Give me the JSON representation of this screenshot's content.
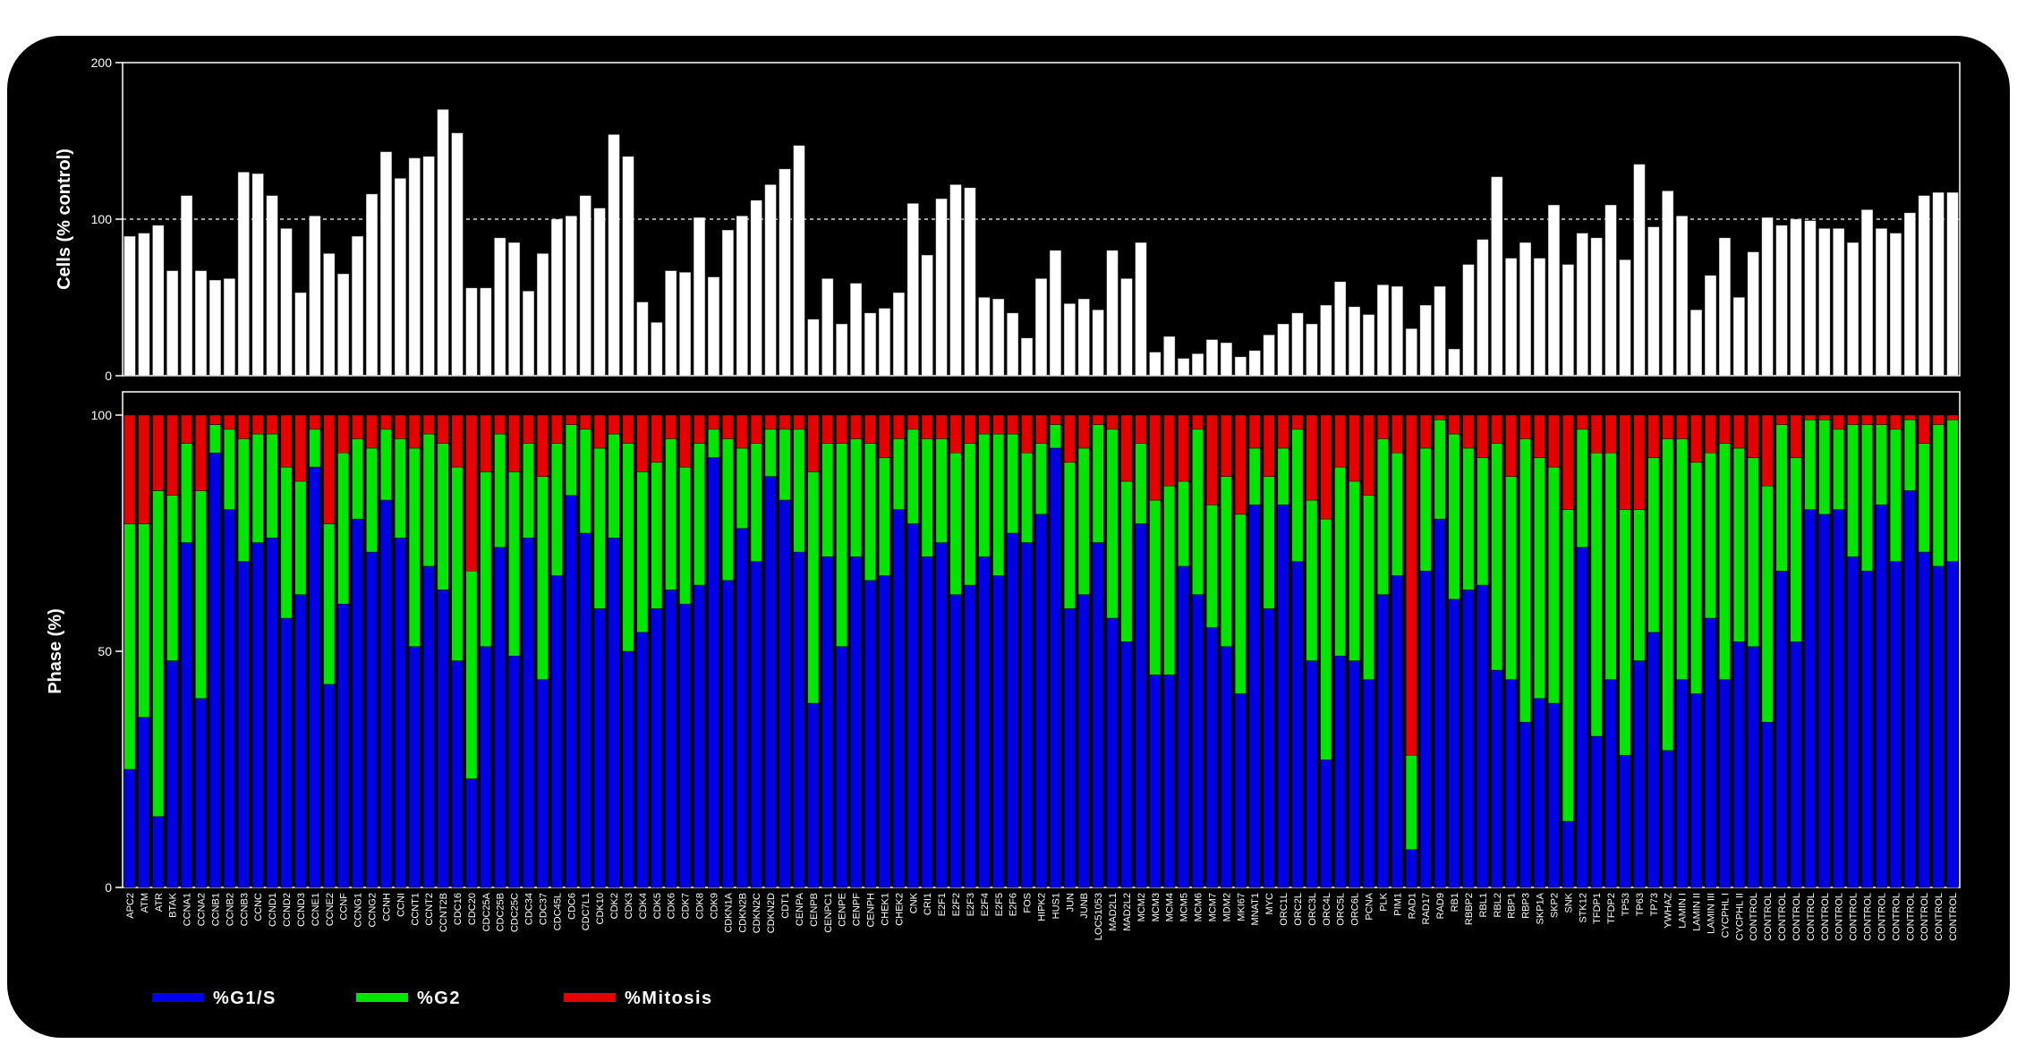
{
  "chart_data": [
    {
      "type": "bar",
      "ylabel": "Cells (% control)",
      "ylim": [
        0,
        200
      ],
      "yticks": [
        0,
        100,
        200
      ],
      "reference_line": 100,
      "grid": false,
      "categories": [
        "APC2",
        "ATM",
        "ATR",
        "BTAK",
        "CCNA1",
        "CCNA2",
        "CCNB1",
        "CCNB2",
        "CCNB3",
        "CCNC",
        "CCND1",
        "CCND2",
        "CCND3",
        "CCNE1",
        "CCNE2",
        "CCNF",
        "CCNG1",
        "CCNG2",
        "CCNH",
        "CCNI",
        "CCNT1",
        "CCNT2",
        "CCNT2B",
        "CDC16",
        "CDC20",
        "CDC25A",
        "CDC25B",
        "CDC25C",
        "CDC34",
        "CDC37",
        "CDC45L",
        "CDC6",
        "CDC7L1",
        "CDK10",
        "CDK2",
        "CDK3",
        "CDK4",
        "CDK5",
        "CDK6",
        "CDK7",
        "CDK8",
        "CDK9",
        "CDKN1A",
        "CDKN2B",
        "CDKN2C",
        "CDKN2D",
        "CDT1",
        "CENPA",
        "CENPB",
        "CENPC1",
        "CENPE",
        "CENPF",
        "CENPH",
        "CHEK1",
        "CHEK2",
        "CNK",
        "CRI1",
        "E2F1",
        "E2F2",
        "E2F3",
        "E2F4",
        "E2F5",
        "E2F6",
        "FOS",
        "HIPK2",
        "HUS1",
        "JUN",
        "JUNB",
        "LOC51053",
        "MAD2L1",
        "MAD2L2",
        "MCM2",
        "MCM3",
        "MCM4",
        "MCM5",
        "MCM6",
        "MCM7",
        "MDM2",
        "MKI67",
        "MNAT1",
        "MYC",
        "ORC1L",
        "ORC2L",
        "ORC3L",
        "ORC4L",
        "ORC5L",
        "ORC6L",
        "PCNA",
        "PLK",
        "PIM1",
        "RAD1",
        "RAD17",
        "RAD9",
        "RB1",
        "RBBP2",
        "RBL1",
        "RBL2",
        "RBP1",
        "RBP3",
        "SKP1A",
        "SKP2",
        "SNK",
        "STK12",
        "TFDP1",
        "TFDP2",
        "TP53",
        "TP63",
        "TP73",
        "YWHAZ",
        "LAMIN I",
        "LAMIN II",
        "LAMIN III",
        "CYCPHL I",
        "CYCPHL II",
        "CONTROL",
        "CONTROL",
        "CONTROL",
        "CONTROL",
        "CONTROL",
        "CONTROL",
        "CONTROL",
        "CONTROL",
        "CONTROL",
        "CONTROL",
        "CONTROL",
        "CONTROL",
        "CONTROL",
        "CONTROL",
        "CONTROL"
      ],
      "values": [
        89,
        91,
        96,
        67,
        115,
        67,
        61,
        62,
        130,
        129,
        115,
        94,
        53,
        102,
        78,
        65,
        89,
        116,
        143,
        126,
        139,
        140,
        170,
        155,
        56,
        56,
        88,
        85,
        54,
        78,
        100,
        102,
        115,
        107,
        154,
        140,
        47,
        34,
        67,
        66,
        101,
        63,
        93,
        102,
        112,
        122,
        132,
        147,
        36,
        62,
        33,
        59,
        40,
        43,
        53,
        110,
        77,
        113,
        122,
        120,
        50,
        49,
        40,
        24,
        62,
        80,
        46,
        49,
        42,
        80,
        62,
        85,
        15,
        25,
        11,
        14,
        23,
        21,
        12,
        16,
        26,
        33,
        40,
        33,
        45,
        60,
        44,
        39,
        58,
        57,
        30,
        45,
        57,
        17,
        71,
        87,
        127,
        75,
        85,
        75,
        109,
        71,
        91,
        88,
        109,
        74,
        135,
        95,
        118,
        102,
        42,
        64,
        88,
        50,
        79,
        101,
        96,
        100,
        99,
        94,
        94,
        85,
        106,
        94,
        91,
        104,
        115,
        117,
        117
      ]
    },
    {
      "type": "bar",
      "stacked": true,
      "ylabel": "Phase (%)",
      "ylim": [
        0,
        100
      ],
      "yticks": [
        0,
        50,
        100
      ],
      "grid": false,
      "legend_position": "bottom-left",
      "categories_ref": "same as panel above",
      "series": [
        {
          "name": "%G1/S",
          "color": "#0000e6",
          "values": [
            25,
            36,
            15,
            48,
            73,
            40,
            92,
            80,
            69,
            73,
            74,
            57,
            62,
            89,
            43,
            60,
            78,
            71,
            82,
            74,
            51,
            68,
            63,
            48,
            23,
            51,
            72,
            49,
            74,
            44,
            66,
            83,
            75,
            59,
            74,
            50,
            54,
            59,
            63,
            60,
            64,
            91,
            65,
            76,
            69,
            87,
            82,
            71,
            39,
            70,
            51,
            70,
            65,
            66,
            80,
            77,
            70,
            73,
            62,
            64,
            70,
            66,
            75,
            73,
            79,
            93,
            59,
            62,
            73,
            57,
            52,
            77,
            45,
            45,
            68,
            62,
            55,
            51,
            41,
            81,
            59,
            81,
            69,
            48,
            27,
            49,
            48,
            44,
            62,
            66,
            8,
            67,
            78,
            61,
            63,
            64,
            46,
            44,
            35,
            40,
            39,
            14,
            72,
            32,
            44,
            28,
            48,
            54,
            29,
            44,
            41,
            57,
            44,
            52,
            51,
            35,
            67,
            52,
            80,
            79,
            80,
            70,
            67,
            81,
            69,
            84,
            71,
            68,
            69
          ],
          "caption": "values above run left to right, one per bar"
        },
        {
          "name": "%G2",
          "color": "#00e600",
          "values": [
            52,
            41,
            69,
            35,
            21,
            44,
            6,
            17,
            26,
            23,
            22,
            32,
            24,
            8,
            34,
            32,
            17,
            22,
            15,
            21,
            42,
            28,
            31,
            41,
            44,
            37,
            24,
            39,
            20,
            43,
            28,
            15,
            22,
            34,
            22,
            44,
            34,
            31,
            32,
            29,
            30,
            6,
            30,
            17,
            25,
            10,
            15,
            26,
            49,
            24,
            43,
            25,
            29,
            25,
            15,
            20,
            25,
            22,
            30,
            30,
            26,
            30,
            21,
            19,
            15,
            5,
            31,
            31,
            25,
            40,
            34,
            17,
            37,
            40,
            18,
            35,
            26,
            36,
            38,
            12,
            28,
            12,
            28,
            34,
            51,
            40,
            38,
            39,
            33,
            26,
            20,
            26,
            21,
            35,
            30,
            27,
            48,
            43,
            60,
            51,
            50,
            66,
            25,
            60,
            48,
            52,
            32,
            37,
            66,
            51,
            49,
            35,
            50,
            41,
            40,
            50,
            31,
            39,
            19,
            20,
            17,
            28,
            31,
            17,
            28,
            15,
            23,
            30,
            30
          ]
        },
        {
          "name": "%Mitosis",
          "color": "#e60000",
          "values": [
            23,
            23,
            16,
            17,
            6,
            16,
            2,
            3,
            5,
            4,
            4,
            11,
            14,
            3,
            23,
            8,
            5,
            7,
            3,
            5,
            7,
            4,
            6,
            11,
            33,
            12,
            4,
            12,
            6,
            13,
            6,
            2,
            3,
            7,
            4,
            6,
            12,
            10,
            5,
            11,
            6,
            3,
            5,
            7,
            6,
            3,
            3,
            3,
            12,
            6,
            6,
            5,
            6,
            9,
            5,
            3,
            5,
            5,
            8,
            6,
            4,
            4,
            4,
            8,
            6,
            2,
            10,
            7,
            2,
            3,
            14,
            6,
            18,
            15,
            14,
            3,
            19,
            13,
            21,
            7,
            13,
            7,
            3,
            18,
            22,
            11,
            14,
            17,
            5,
            8,
            72,
            7,
            1,
            4,
            7,
            9,
            6,
            13,
            5,
            9,
            11,
            20,
            3,
            8,
            8,
            20,
            20,
            9,
            5,
            5,
            10,
            8,
            6,
            7,
            9,
            15,
            2,
            9,
            1,
            1,
            3,
            2,
            2,
            2,
            3,
            1,
            6,
            2,
            1
          ]
        }
      ]
    }
  ]
}
